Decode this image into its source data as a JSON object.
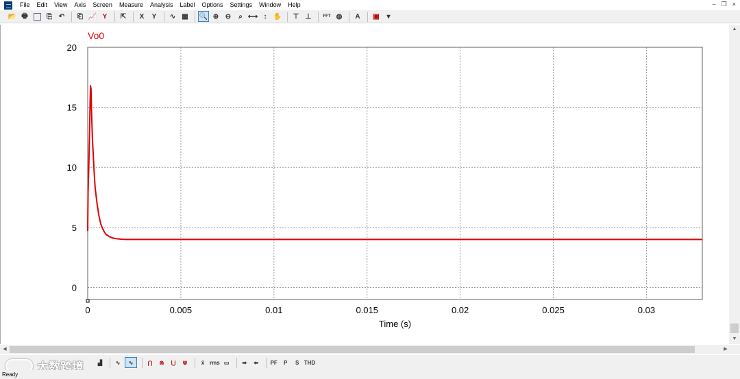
{
  "menu": [
    "File",
    "Edit",
    "View",
    "Axis",
    "Screen",
    "Measure",
    "Analysis",
    "Label",
    "Options",
    "Settings",
    "Window",
    "Help"
  ],
  "window_controls": [
    "–",
    "❐",
    "×"
  ],
  "toolbar_labels": {
    "x_axis": "X",
    "y_axis": "Y",
    "fft": "FFT",
    "text": "A"
  },
  "bottom_toolbar": {
    "pf": "PF",
    "p": "P",
    "s": "S",
    "thd": "THD",
    "rms": "rms"
  },
  "watermark": "大数跨境",
  "status": "Ready",
  "chart_data": {
    "type": "line",
    "title": "Vo0",
    "xlabel": "Time (s)",
    "ylabel": "",
    "xlim": [
      0,
      0.033
    ],
    "ylim": [
      -1,
      20
    ],
    "xticks": [
      0,
      0.005,
      0.01,
      0.015,
      0.02,
      0.025,
      0.03
    ],
    "xtick_labels": [
      "0",
      "0.005",
      "0.01",
      "0.015",
      "0.02",
      "0.025",
      "0.03"
    ],
    "yticks": [
      0,
      5,
      10,
      15,
      20
    ],
    "ytick_labels": [
      "0",
      "5",
      "10",
      "15",
      "20"
    ],
    "grid": true,
    "series": [
      {
        "name": "Vo0",
        "color": "#e00000",
        "x": [
          0,
          2e-05,
          5e-05,
          0.0001,
          0.00013,
          0.00015,
          0.00018,
          0.0002,
          0.00023,
          0.00025,
          0.0003,
          0.00035,
          0.0004,
          0.0005,
          0.0006,
          0.0007,
          0.0008,
          0.0009,
          0.001,
          0.0012,
          0.0014,
          0.0016,
          0.0018,
          0.002,
          0.0022,
          0.0025,
          0.003,
          0.005,
          0.01,
          0.015,
          0.02,
          0.025,
          0.03,
          0.033
        ],
        "y": [
          4.7,
          8.0,
          9.5,
          13.0,
          15.5,
          16.8,
          16.5,
          15.0,
          13.5,
          12.5,
          11.0,
          9.5,
          8.3,
          7.0,
          6.0,
          5.3,
          4.9,
          4.6,
          4.4,
          4.2,
          4.1,
          4.05,
          4.02,
          4.0,
          4.0,
          4.0,
          4.0,
          4.0,
          4.0,
          4.0,
          4.0,
          4.0,
          4.0,
          4.0
        ]
      }
    ]
  }
}
